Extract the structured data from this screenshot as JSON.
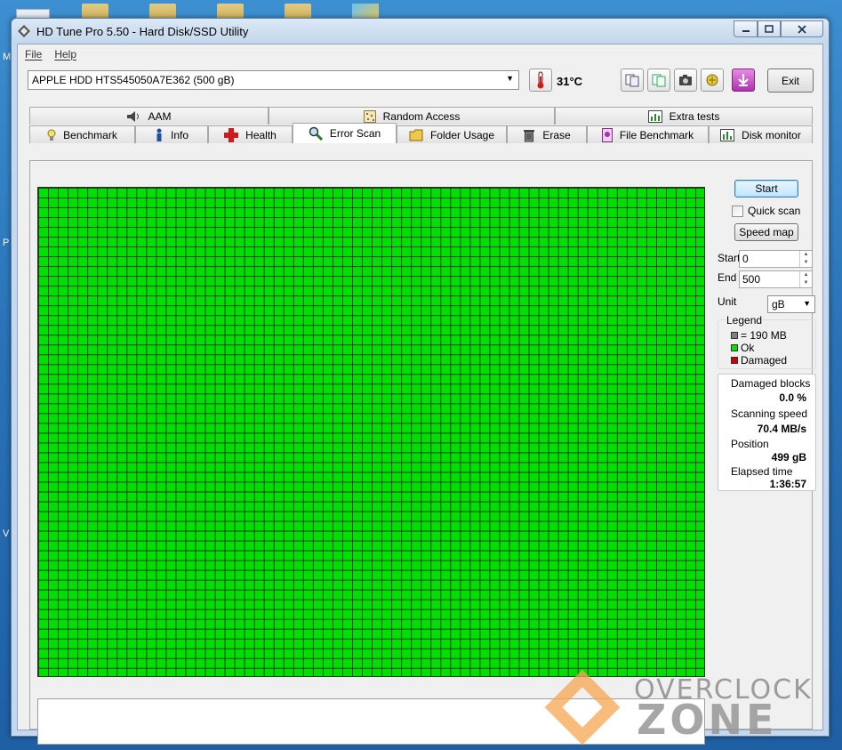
{
  "window": {
    "title": "HD Tune Pro 5.50 - Hard Disk/SSD Utility"
  },
  "menu": [
    {
      "label": "File"
    },
    {
      "label": "Help"
    }
  ],
  "toolbar": {
    "drive": "APPLE HDD HTS545050A7E362 (500 gB)",
    "temperature": "31°C",
    "exit_label": "Exit"
  },
  "tabs_top": [
    {
      "label": "AAM"
    },
    {
      "label": "Random Access"
    },
    {
      "label": "Extra tests"
    }
  ],
  "tabs_bottom": [
    {
      "label": "Benchmark"
    },
    {
      "label": "Info"
    },
    {
      "label": "Health"
    },
    {
      "label": "Error Scan"
    },
    {
      "label": "Folder Usage"
    },
    {
      "label": "Erase"
    },
    {
      "label": "File Benchmark"
    },
    {
      "label": "Disk monitor"
    }
  ],
  "active_tab": "Error Scan",
  "scan": {
    "start_label": "Start",
    "quick_scan_label": "Quick scan",
    "quick_scan_checked": false,
    "speed_map_label": "Speed map",
    "start_field_label": "Start",
    "start_value": "0",
    "end_field_label": "End",
    "end_value": "500",
    "unit_label": "Unit",
    "unit_value": "gB"
  },
  "legend": {
    "title": "Legend",
    "block_size": "= 190 MB",
    "ok": "Ok",
    "damaged": "Damaged",
    "colors": {
      "block": "#808080",
      "ok": "#00e000",
      "damaged": "#cc0000"
    }
  },
  "stats": {
    "damaged_blocks_label": "Damaged blocks",
    "damaged_blocks_value": "0.0 %",
    "scanning_speed_label": "Scanning speed",
    "scanning_speed_value": "70.4 MB/s",
    "position_label": "Position",
    "position_value": "499 gB",
    "elapsed_label": "Elapsed time",
    "elapsed_value": "1:36:57"
  },
  "watermark": {
    "line1": "OVERCLOCK",
    "line2": "ZONE"
  },
  "desktop": {
    "left_chars": [
      "M",
      "P",
      "V"
    ]
  }
}
